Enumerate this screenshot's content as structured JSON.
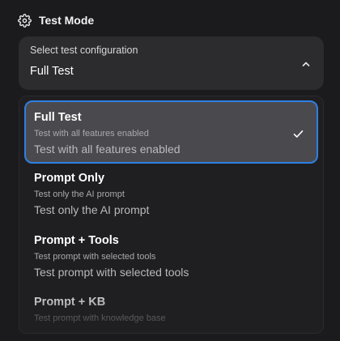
{
  "header": {
    "icon": "gear-icon",
    "title": "Test Mode"
  },
  "select": {
    "label": "Select test configuration",
    "value": "Full Test",
    "chevron_icon": "chevron-up-icon"
  },
  "options": [
    {
      "title": "Full Test",
      "desc_small": "Test with all features enabled",
      "desc": "Test with all features enabled",
      "selected": true
    },
    {
      "title": "Prompt Only",
      "desc_small": "Test only the AI prompt",
      "desc": "Test only the AI prompt",
      "selected": false
    },
    {
      "title": "Prompt + Tools",
      "desc_small": "Test prompt with selected tools",
      "desc": "Test prompt with selected tools",
      "selected": false
    },
    {
      "title": "Prompt + KB",
      "desc_small": "Test prompt with knowledge base",
      "selected": false
    }
  ],
  "colors": {
    "accent": "#2f7fe0",
    "selected_bg": "#4a4a4e",
    "panel_bg": "#2c2c2f"
  }
}
